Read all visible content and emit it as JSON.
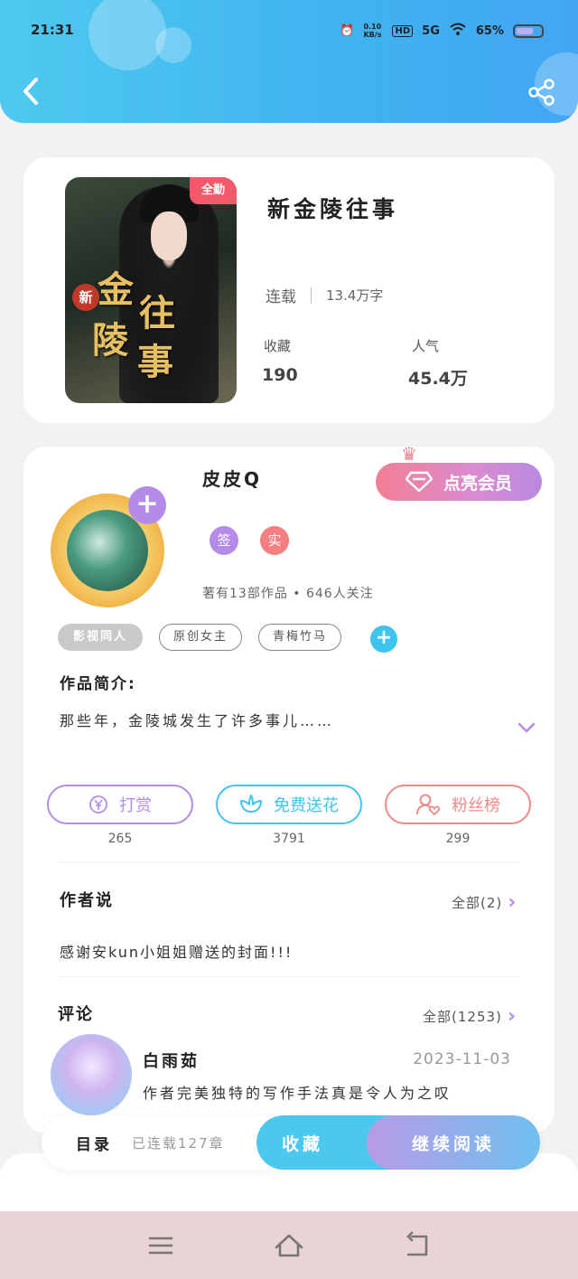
{
  "status_bar": {
    "time": "21:31",
    "network_speed": "0.10 KB/s",
    "hd": "HD",
    "signal": "5G",
    "battery": "65%"
  },
  "header": {
    "back_icon": "back-chevron-icon",
    "share_icon": "share-icon"
  },
  "book": {
    "badge": "全勤",
    "cover_calligraphy": [
      "金",
      "陵",
      "往",
      "事"
    ],
    "cover_seal": "新",
    "title": "新金陵往事",
    "status": "连载",
    "word_count": "13.4万字",
    "stats": [
      {
        "label": "收藏",
        "value": "190"
      },
      {
        "label": "人气",
        "value": "45.4万"
      }
    ]
  },
  "author": {
    "name": "皮皮Q",
    "vip_button": "点亮会员",
    "badges": [
      {
        "label": "签",
        "color": "#b48ce8"
      },
      {
        "label": "实",
        "color": "#f37f80"
      }
    ],
    "works_info": "著有13部作品 • 646人关注",
    "tags": [
      "影视同人",
      "原创女主",
      "青梅竹马"
    ],
    "intro_label": "作品简介:",
    "intro_text": "那些年，金陵城发生了许多事儿……"
  },
  "actions": [
    {
      "label": "打赏",
      "count": "265",
      "color": "#b48ce8",
      "icon": "yen-coin-icon"
    },
    {
      "label": "免费送花",
      "count": "3791",
      "color": "#3fc4ee",
      "icon": "flower-icon"
    },
    {
      "label": "粉丝榜",
      "count": "299",
      "color": "#f08a8a",
      "icon": "fan-ranking-icon"
    }
  ],
  "author_says": {
    "title": "作者说",
    "more": "全部(2)",
    "text": "感谢安kun小姐姐赠送的封面!!!"
  },
  "comments": {
    "title": "评论",
    "more": "全部(1253)",
    "items": [
      {
        "user": "白雨茹",
        "date": "2023-11-03",
        "text": "作者完美独特的写作手法真是令人为之叹"
      }
    ]
  },
  "bottom_bar": {
    "toc": "目录",
    "chapters": "已连载127章",
    "collect": "收藏",
    "read": "继续阅读"
  },
  "colors": {
    "header_blue": "#42b4f0",
    "accent_purple": "#b48ce8",
    "accent_cyan": "#3fc4ee",
    "accent_pink": "#f37f94"
  }
}
